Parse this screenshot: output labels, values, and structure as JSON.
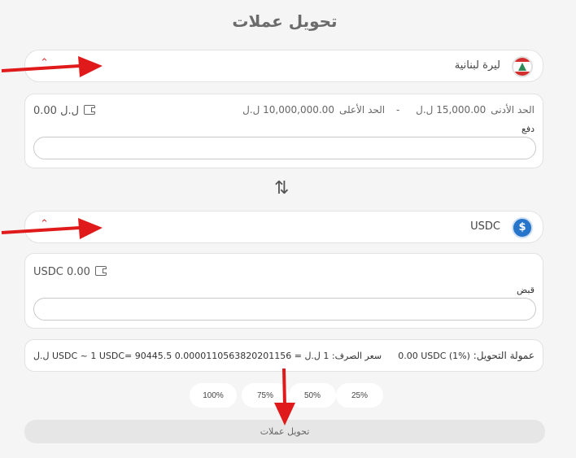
{
  "title": "تحويل عملات",
  "from": {
    "currency_label": "ليرة لبنانية",
    "icon": "lebanon-flag-icon",
    "balance": "0.00 ل.ل",
    "min_label": "الحد الأدنى",
    "min_value": "15,000.00 ل.ل",
    "separator": "-",
    "max_label": "الحد الأعلى",
    "max_value": "10,000,000.00 ل.ل",
    "field_label": "دفع",
    "field_value": ""
  },
  "to": {
    "currency_label": "USDC",
    "icon": "usdc-coin-icon",
    "balance": "USDC 0.00",
    "field_label": "قبض",
    "field_value": ""
  },
  "info": {
    "fee_label": "عمولة التحويل:",
    "fee_value": "0.00 USDC (1%)",
    "rate_text": "سعر الصرف: 1 ل.ل = 0.0000110563820201156 USDC ~ 1 USDC= 90445.5 ل.ل"
  },
  "percent_buttons": [
    "100%",
    "75%",
    "50%",
    "25%"
  ],
  "submit_label": "تحويل عملات",
  "colors": {
    "accent_arrow": "#e01a1a",
    "usdc_blue": "#2775ca",
    "lebanon_red": "#d32f2f",
    "cedar_green": "#2e8b57"
  }
}
